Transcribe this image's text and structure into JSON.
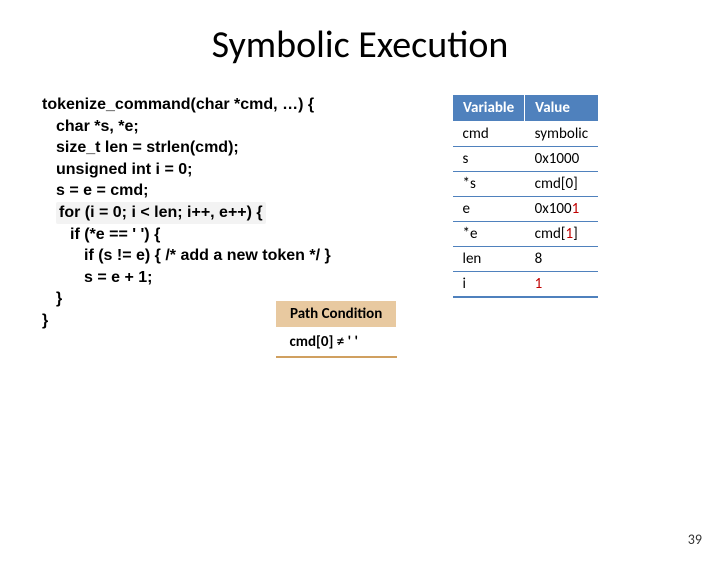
{
  "title": "Symbolic Execution",
  "code": {
    "l1": "tokenize_command(char *cmd, …) {",
    "l2": "char *s, *e;",
    "l3": "size_t len = strlen(cmd);",
    "l4": "unsigned int i = 0;",
    "l5": "s = e = cmd;",
    "l6": "for (i = 0; i < len; i++, e++) {",
    "l7": "if (*e == ' ') {",
    "l8": "if (s != e) { /* add a new token */ }",
    "l9": "s = e + 1;",
    "l10": "}",
    "l11": "}"
  },
  "vars": {
    "h1": "Variable",
    "h2": "Value",
    "rows": [
      {
        "k": "cmd",
        "v": "symbolic"
      },
      {
        "k": "s",
        "v": "0x1000"
      },
      {
        "k": "*s",
        "v": "cmd[0]"
      },
      {
        "k": "e",
        "v_pre": "0x100",
        "v_red": "1"
      },
      {
        "k": "*e",
        "v_pre": "cmd[",
        "v_red": "1",
        "v_post": "]"
      },
      {
        "k": "len",
        "v": "8"
      },
      {
        "k": "i",
        "v_red": "1"
      }
    ]
  },
  "path": {
    "h": "Path Condition",
    "c": "cmd[0] ≠ ' '"
  },
  "slidenum": "39"
}
